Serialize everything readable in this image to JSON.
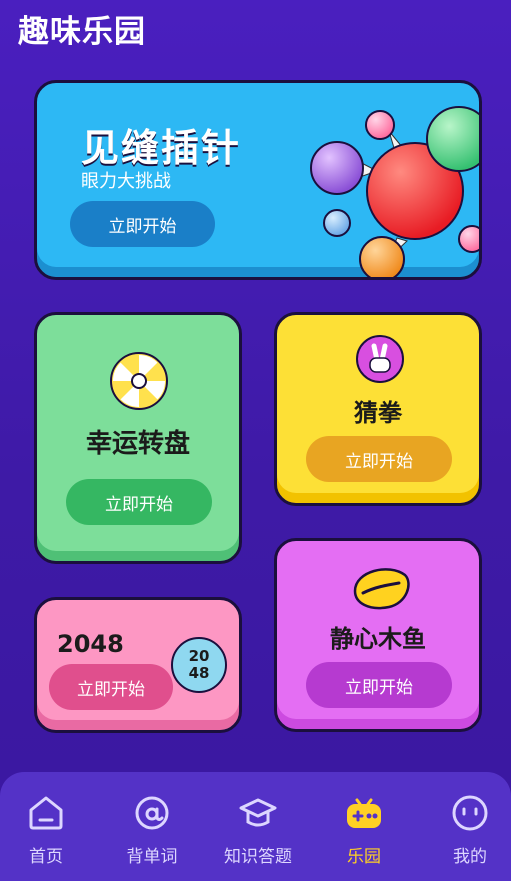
{
  "app_title": "趣味乐园",
  "games": {
    "needle": {
      "title": "见缝插针",
      "subtitle": "眼力大挑战",
      "button": "立即开始"
    },
    "wheel": {
      "title": "幸运转盘",
      "button": "立即开始"
    },
    "rps": {
      "title": "猜拳",
      "button": "立即开始"
    },
    "g2048": {
      "title": "2048",
      "badge": [
        "20",
        "48"
      ],
      "button": "立即开始"
    },
    "fish": {
      "title": "静心木鱼",
      "button": "立即开始"
    }
  },
  "nav": {
    "items": [
      {
        "label": "首页",
        "icon": "home-icon"
      },
      {
        "label": "背单词",
        "icon": "at-icon"
      },
      {
        "label": "知识答题",
        "icon": "graduation-cap-icon"
      },
      {
        "label": "乐园",
        "icon": "gamepad-icon",
        "active": true
      },
      {
        "label": "我的",
        "icon": "face-icon"
      }
    ]
  },
  "colors": {
    "active": "#ffd024",
    "nav_bg": "#5432c7"
  }
}
